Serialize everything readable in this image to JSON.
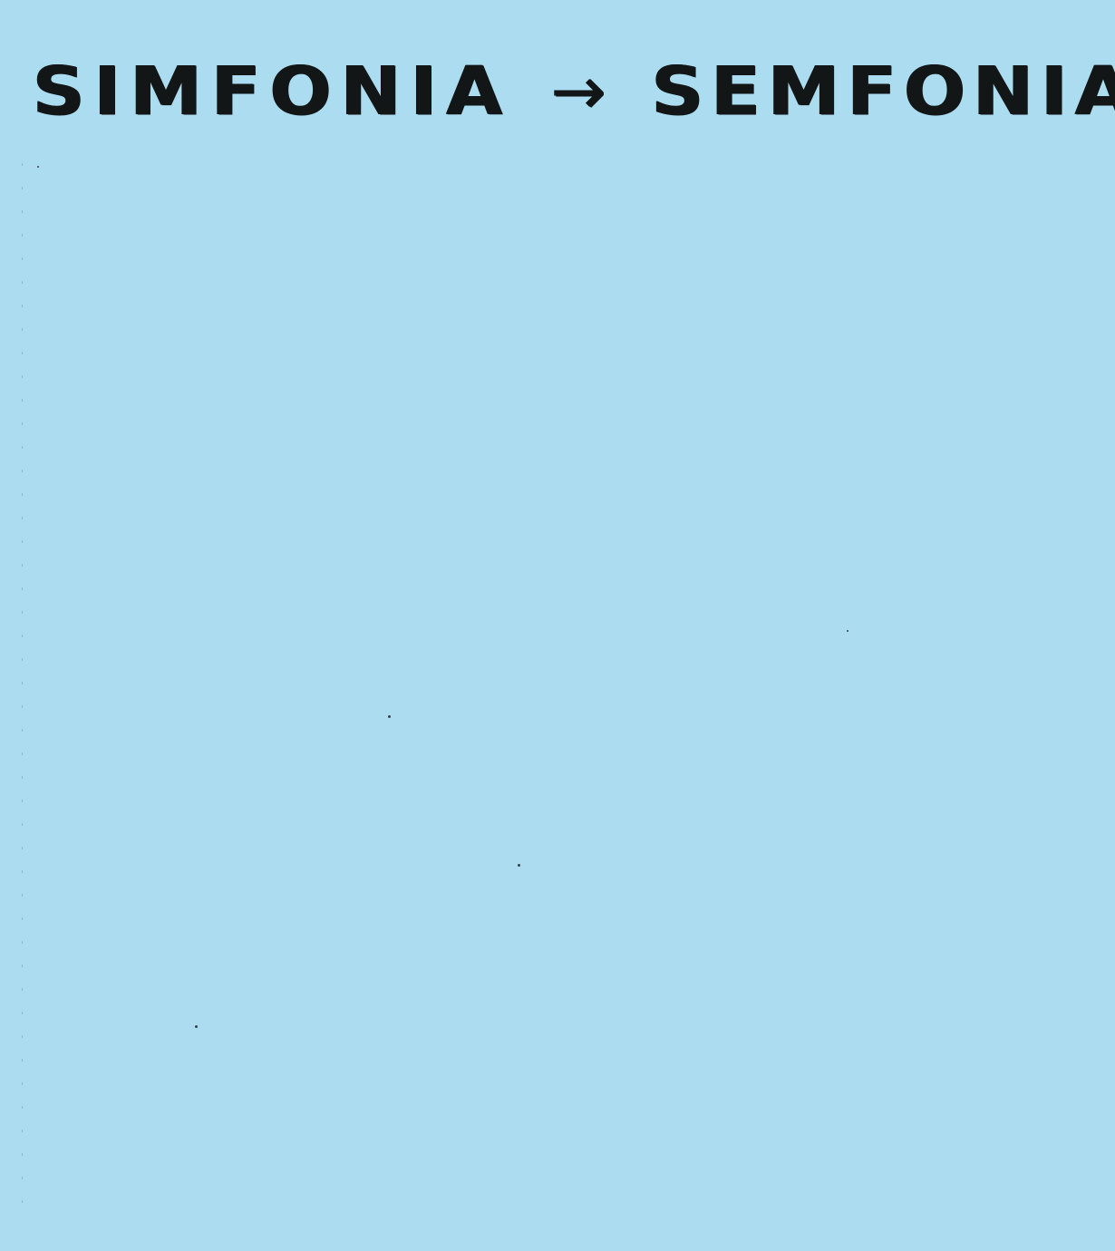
{
  "note": {
    "from_word": "SIMFONIA",
    "arrow": "→",
    "to_word": "SEMFONIA"
  },
  "colors": {
    "paper": "#abdcef",
    "ink": "#121617"
  }
}
